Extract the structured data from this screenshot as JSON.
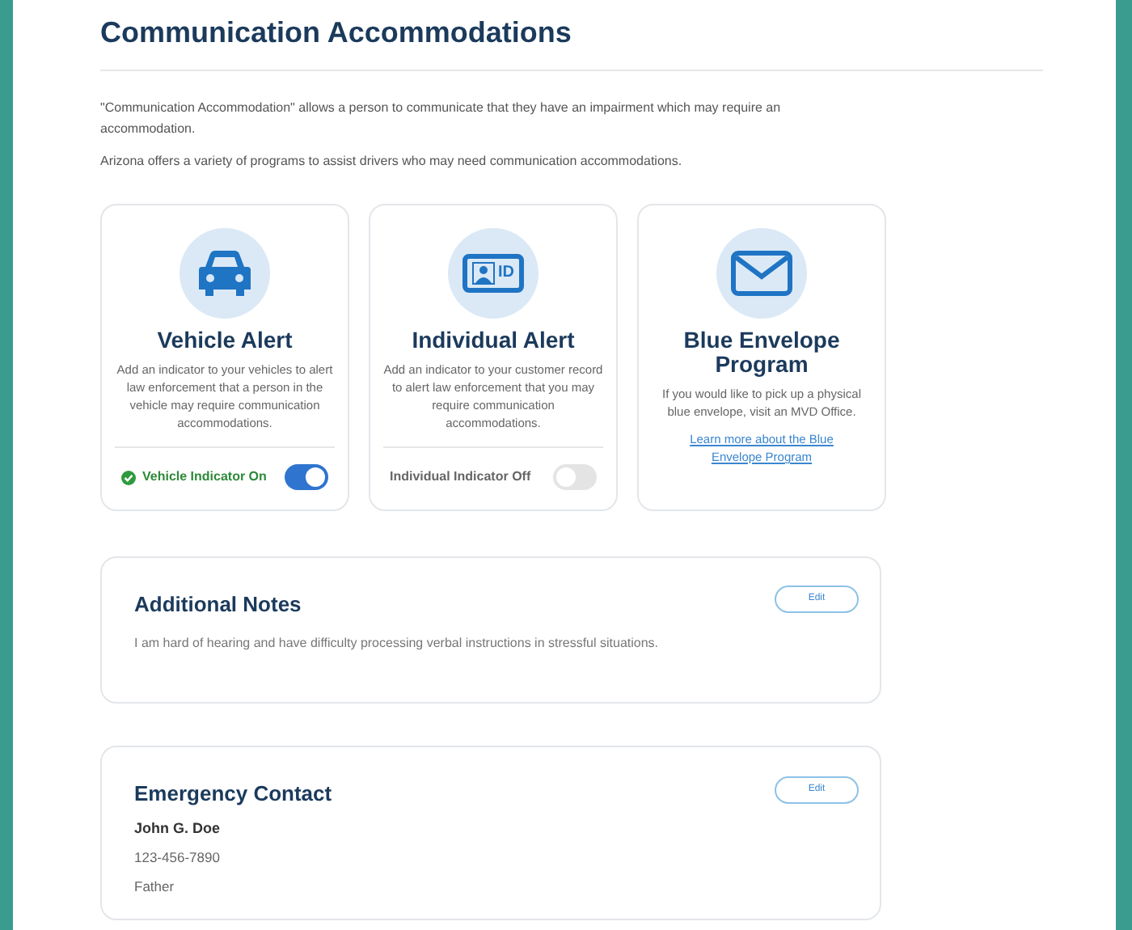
{
  "title": "Communication Accommodations",
  "intro": [
    "\"Communication Accommodation\" allows a person to communicate that they have an impairment which may require an accommodation.",
    "Arizona offers a variety of programs to assist drivers who may need communication accommodations."
  ],
  "programs": [
    {
      "kind": "vehicle",
      "title": "Vehicle Alert",
      "description": "Add an indicator to your vehicles to alert law enforcement that a person in the vehicle may require communication accommodations.",
      "toggle": {
        "label": "Vehicle Indicator On",
        "on": true
      }
    },
    {
      "kind": "individual",
      "icon_label": "ID",
      "title": "Individual Alert",
      "description": "Add an indicator to your customer record to alert law enforcement that you may require communication accommodations.",
      "toggle": {
        "label": "Individual Indicator Off",
        "on": false
      }
    },
    {
      "kind": "envelope",
      "title": "Blue Envelope Program",
      "description": "If you would like to pick up a physical blue envelope, visit an MVD Office.",
      "link": "Learn more about the Blue Envelope Program"
    }
  ],
  "notes": {
    "title": "Additional Notes",
    "button": "Edit",
    "text": "I am hard of hearing and have difficulty processing verbal instructions in stressful situations."
  },
  "emergency_contact": {
    "title": "Emergency Contact",
    "button": "Edit",
    "name": "John G. Doe",
    "phone": "123-456-7890",
    "relation": "Father"
  }
}
